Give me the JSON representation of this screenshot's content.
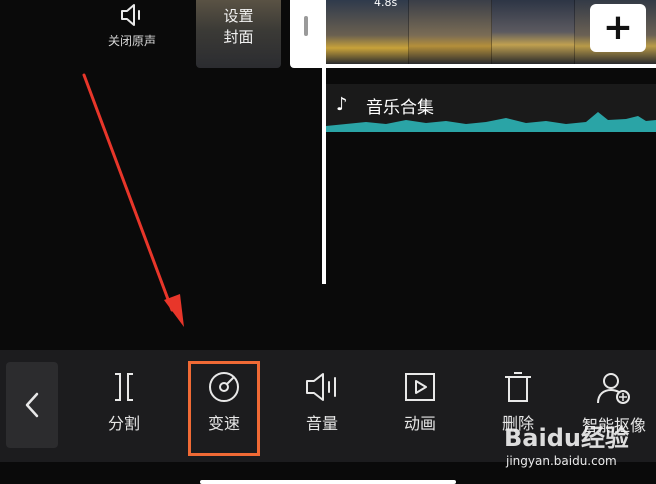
{
  "top": {
    "mute_label": "关闭原声",
    "cover_label": "设置\n封面",
    "clip_duration": "4.8s"
  },
  "music": {
    "title": "音乐合集",
    "waveform_color": "#2aa4a6"
  },
  "toolbar": {
    "items": [
      {
        "label": "分割",
        "icon": "split-icon"
      },
      {
        "label": "变速",
        "icon": "speed-icon"
      },
      {
        "label": "音量",
        "icon": "volume-icon"
      },
      {
        "label": "动画",
        "icon": "animation-icon"
      },
      {
        "label": "删除",
        "icon": "delete-icon"
      },
      {
        "label": "智能抠像",
        "icon": "smart-cutout-icon"
      }
    ],
    "highlight_color": "#f06a35"
  },
  "annotation": {
    "arrow_color": "#e8362a"
  },
  "watermark": {
    "logo": "Baidu经验",
    "url": "jingyan.baidu.com"
  }
}
